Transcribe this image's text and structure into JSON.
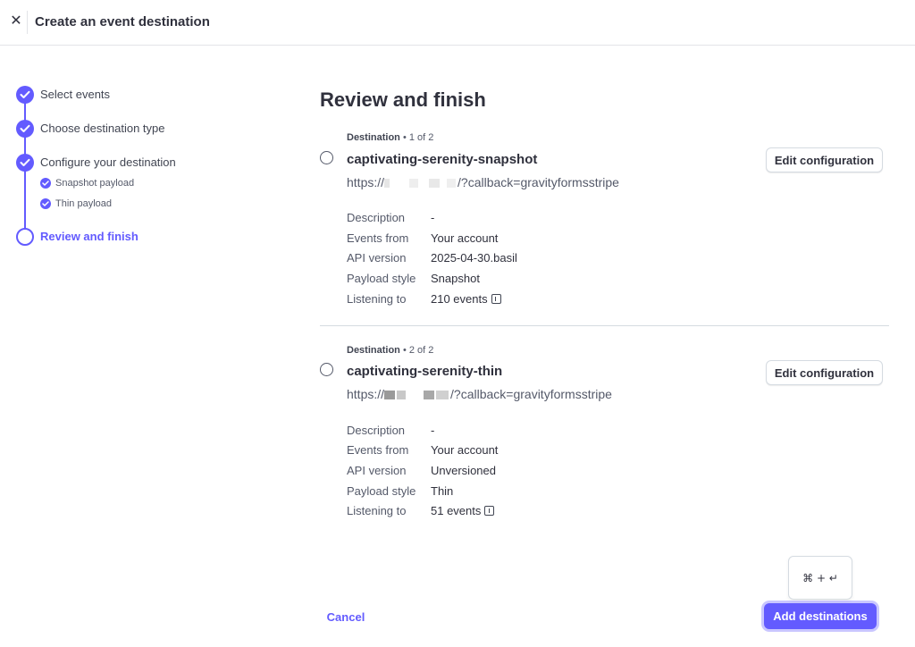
{
  "header": {
    "close_glyph": "✕",
    "title": "Create an event destination"
  },
  "stepper": {
    "steps": [
      {
        "label": "Select events",
        "state": "done"
      },
      {
        "label": "Choose destination type",
        "state": "done"
      },
      {
        "label": "Configure your destination",
        "state": "done",
        "substeps": [
          {
            "label": "Snapshot payload"
          },
          {
            "label": "Thin payload"
          }
        ]
      },
      {
        "label": "Review and finish",
        "state": "current"
      }
    ]
  },
  "main": {
    "title": "Review and finish",
    "destinations": [
      {
        "kicker_label": "Destination",
        "kicker_count": "• 1 of 2",
        "name": "captivating-serenity-snapshot",
        "url_prefix": "https://",
        "url_suffix": "/?callback=gravityformsstripe",
        "edit_label": "Edit configuration",
        "rows": [
          {
            "label": "Description",
            "value": "-"
          },
          {
            "label": "Events from",
            "value": "Your account"
          },
          {
            "label": "API version",
            "value": "2025-04-30.basil"
          },
          {
            "label": "Payload style",
            "value": "Snapshot"
          },
          {
            "label": "Listening to",
            "value": "210 events"
          }
        ]
      },
      {
        "kicker_label": "Destination",
        "kicker_count": "• 2 of 2",
        "name": "captivating-serenity-thin",
        "url_prefix": "https://",
        "url_suffix": "/?callback=gravityformsstripe",
        "edit_label": "Edit configuration",
        "rows": [
          {
            "label": "Description",
            "value": "-"
          },
          {
            "label": "Events from",
            "value": "Your account"
          },
          {
            "label": "API version",
            "value": "Unversioned"
          },
          {
            "label": "Payload style",
            "value": "Thin"
          },
          {
            "label": "Listening to",
            "value": "51 events"
          }
        ]
      }
    ]
  },
  "footer": {
    "shortcut_hint": "⌘ + ↵",
    "cancel_label": "Cancel",
    "submit_label": "Add destinations"
  },
  "colors": {
    "accent": "#635bff",
    "text": "#30313d",
    "muted": "#545969",
    "border": "#d5dbe1"
  }
}
